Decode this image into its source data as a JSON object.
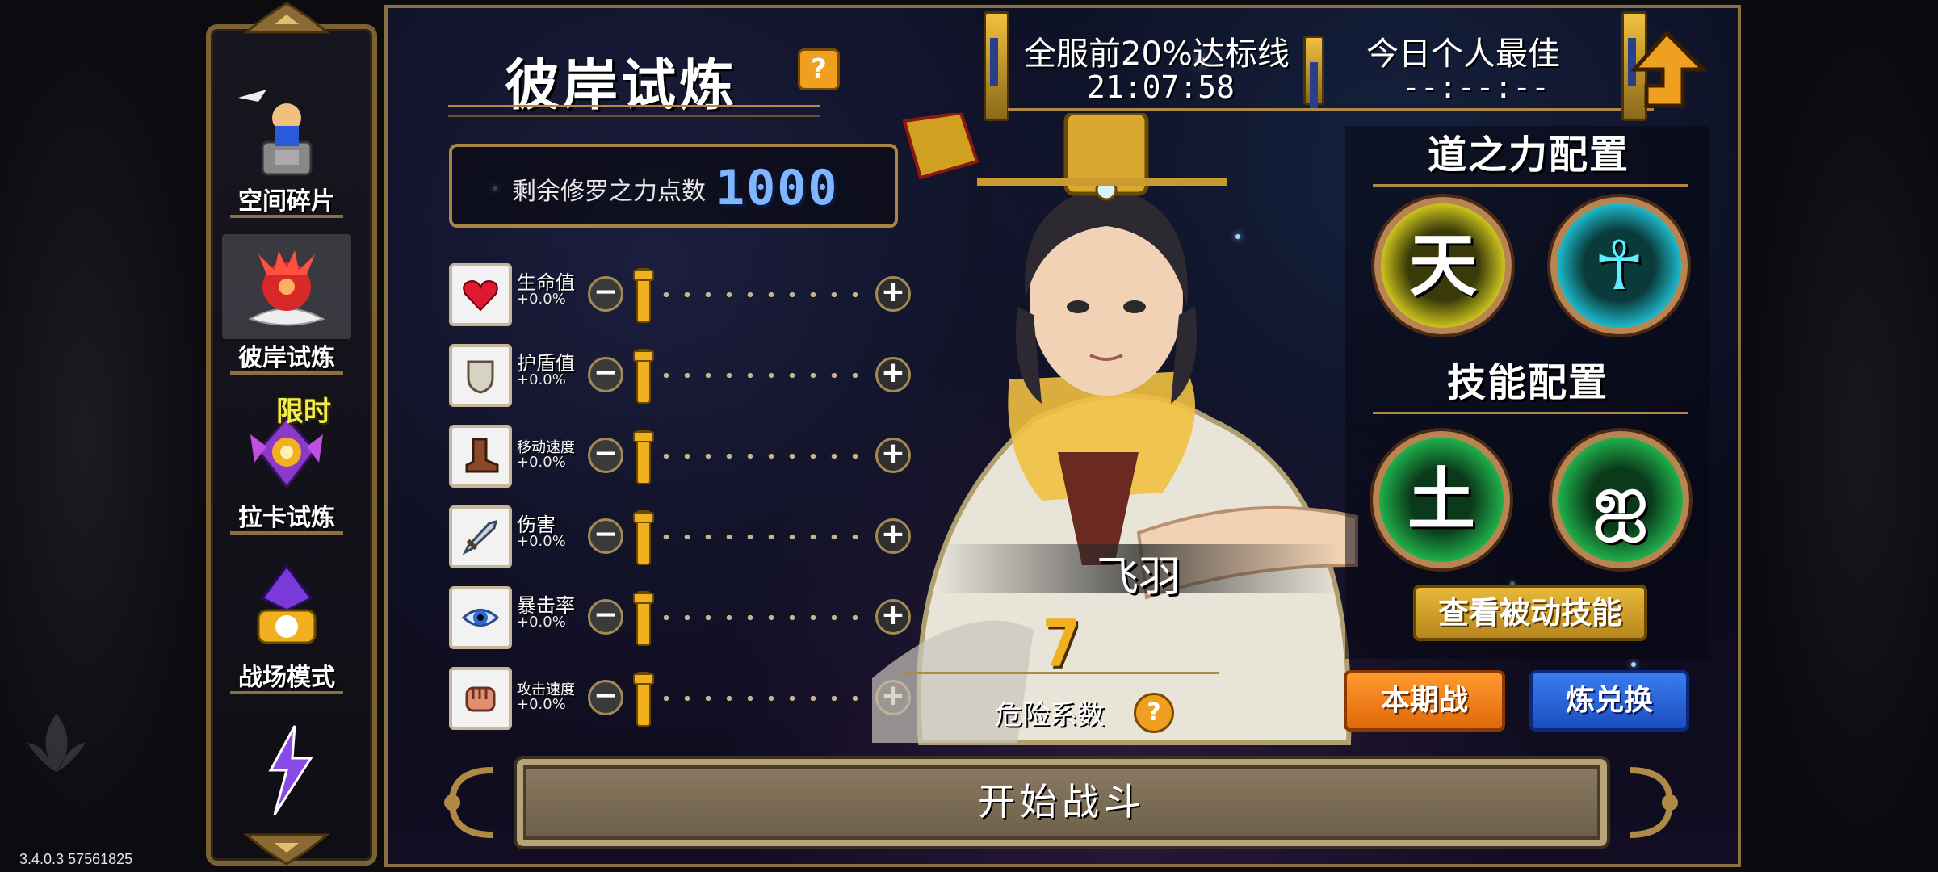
{
  "menu": {
    "items": [
      {
        "label": "空间碎片",
        "icon": "space-fragment-icon"
      },
      {
        "label": "彼岸试炼",
        "icon": "higan-flower-icon",
        "active": true
      },
      {
        "label": "拉卡试炼",
        "icon": "laka-emblem-icon",
        "badge": "限时"
      },
      {
        "label": "战场模式",
        "icon": "battlefield-crystal-icon"
      },
      {
        "label": "",
        "icon": "lightning-icon"
      }
    ]
  },
  "panel": {
    "title": "彼岸试炼",
    "help_icon": "question-icon"
  },
  "top_bar": {
    "server_label": "全服前20%达标线",
    "server_time": "21:07:58",
    "personal_label": "今日个人最佳",
    "personal_time": "--:--:--",
    "back_icon": "back-arrow-icon"
  },
  "points": {
    "label": "剩余修罗之力点数",
    "value": "1000"
  },
  "stats": [
    {
      "name": "生命值",
      "value": "+0.0%",
      "icon": "heart-icon",
      "level": 0
    },
    {
      "name": "护盾值",
      "value": "+0.0%",
      "icon": "shield-icon",
      "level": 0
    },
    {
      "name": "移动速度",
      "value": "+0.0%",
      "icon": "boot-icon",
      "level": 0
    },
    {
      "name": "伤害",
      "value": "+0.0%",
      "icon": "sword-icon",
      "level": 0
    },
    {
      "name": "暴击率",
      "value": "+0.0%",
      "icon": "eye-icon",
      "level": 0
    },
    {
      "name": "攻击速度",
      "value": "+0.0%",
      "icon": "fist-icon",
      "level": 0
    }
  ],
  "character": {
    "name": "飞羽",
    "danger_value": "7",
    "danger_label": "危险系数"
  },
  "config": {
    "dao_title": "道之力配置",
    "dao_orbs": [
      {
        "glyph": "天",
        "color": "#c9c21c"
      },
      {
        "glyph": "☥",
        "color": "#1cb8c9"
      }
    ],
    "skill_title": "技能配置",
    "skill_orbs": [
      {
        "glyph": "土",
        "color": "#1fae4a"
      },
      {
        "glyph": "ஐ",
        "color": "#1fae4a"
      }
    ],
    "passive_button": "查看被动技能",
    "season_button": "本期战",
    "exchange_button": "炼兑换"
  },
  "start_button": "开始战斗",
  "version": "3.4.0.3 57561825",
  "colors": {
    "gold": "#b08a45",
    "points_blue": "#7fb6ff",
    "danger_orange": "#f0b020"
  }
}
